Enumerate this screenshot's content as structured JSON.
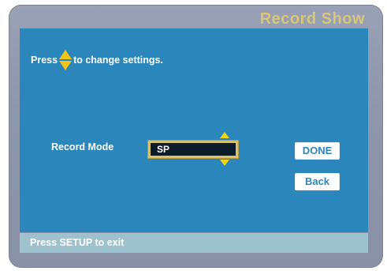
{
  "screen": {
    "title": "Record Show"
  },
  "instruction": {
    "prefix": "Press",
    "suffix": "to change settings.",
    "icon": "up-down-arrows-icon"
  },
  "settings": {
    "record_mode_label": "Record Mode",
    "record_mode_value": "SP"
  },
  "buttons": {
    "done_label": "DONE",
    "back_label": "Back"
  },
  "status": {
    "hint": "Press SETUP to exit"
  },
  "colors": {
    "panel": "#2b86bb",
    "frame": "#9aa1b4",
    "title": "#d8c778",
    "arrow": "#f2c418",
    "status_bar": "#9dc2cd"
  }
}
